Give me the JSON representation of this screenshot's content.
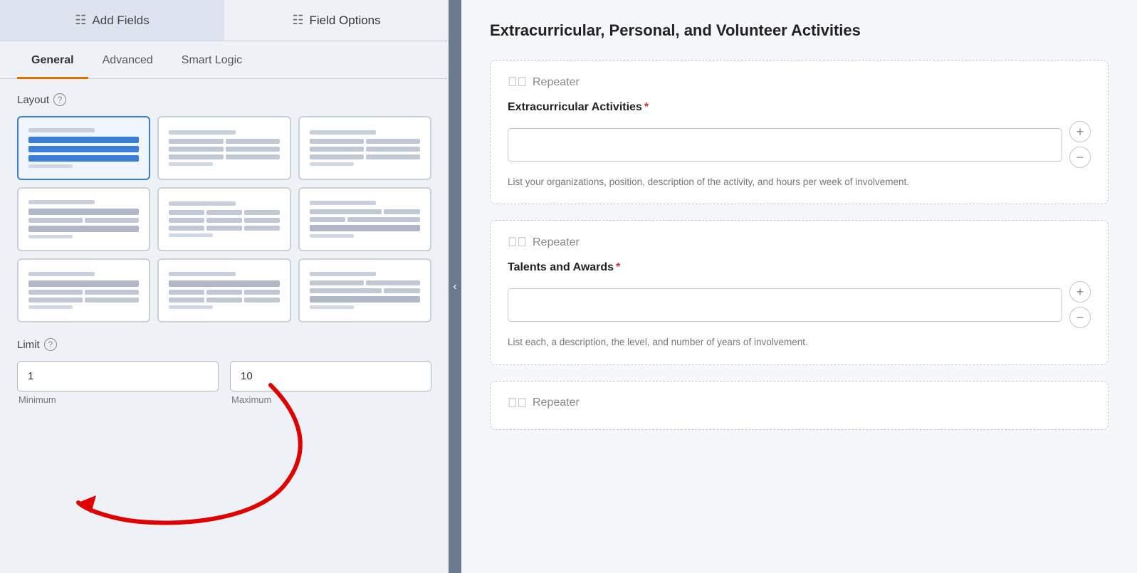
{
  "leftPanel": {
    "topTabs": [
      {
        "id": "add-fields",
        "label": "Add Fields",
        "icon": "☰",
        "active": false
      },
      {
        "id": "field-options",
        "label": "Field Options",
        "icon": "⚙",
        "active": true
      }
    ],
    "subTabs": [
      {
        "id": "general",
        "label": "General",
        "active": true
      },
      {
        "id": "advanced",
        "label": "Advanced",
        "active": false
      },
      {
        "id": "smart-logic",
        "label": "Smart Logic",
        "active": false
      }
    ],
    "layoutSection": {
      "label": "Layout",
      "helpTooltip": "?"
    },
    "limitSection": {
      "label": "Limit",
      "helpTooltip": "?",
      "minLabel": "Minimum",
      "maxLabel": "Maximum",
      "minValue": "1",
      "maxValue": "10"
    }
  },
  "divider": {
    "collapseIcon": "‹"
  },
  "rightPanel": {
    "title": "Extracurricular, Personal, and Volunteer Activities",
    "repeaters": [
      {
        "id": "repeater-1",
        "repeaterLabel": "Repeater",
        "fieldLabel": "Extracurricular Activities",
        "required": true,
        "placeholder": "",
        "hint": "List your organizations, position, description of the activity, and hours per week of involvement."
      },
      {
        "id": "repeater-2",
        "repeaterLabel": "Repeater",
        "fieldLabel": "Talents and Awards",
        "required": true,
        "placeholder": "",
        "hint": "List each, a description, the level, and number of years of involvement."
      },
      {
        "id": "repeater-3",
        "repeaterLabel": "Repeater",
        "fieldLabel": "",
        "required": false,
        "placeholder": "",
        "hint": ""
      }
    ]
  }
}
